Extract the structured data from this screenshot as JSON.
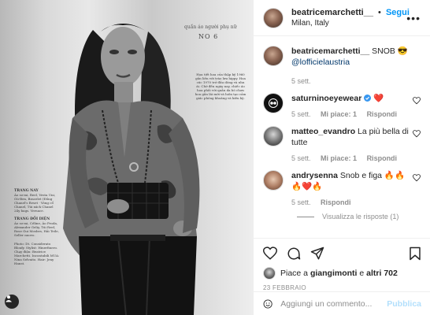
{
  "photo": {
    "issue_label": "NO 6",
    "arc_text": "quần áo người phụ nữ",
    "right_caption": "Họa tiết hoa của thập kỷ 1960 gần liền với trào lưu hippy. Hoa cúc 1970 trở đầu dòng và nhu ái. Chờ đến ngày nay, chiếc áo hoa phối với quần da bó chơn hoa gần lãi mới và luôn tạo cảm giác phóng khoáng và kiêu kỳ.",
    "col_heading_1": "TRANG NAY",
    "col_text_1": "Áo sơ mi, Reel, Vesta Uni, Gü-Ben, Bracelet (Đồng Chanel's Reset · Vòng cổ Chanel, Túi xách Chanel 24y bags. Versace.",
    "col_heading_2": "TRANG ĐỐI DIỆN",
    "col_text_2": "Áo sơ mi, Céline, Áo Proda, Alexander Geliy, Túi Reel, Rose Gui Mosbes, Hải Teile, Seller nuovo.",
    "col_credits": "Photo: Dt. Considerato Bloufy. Stylist: Hinerfinero. Chạy điện: Beatrice Marchetti. Incontabili MUA: Nina Selvaito. Hair: Jeny Hanst."
  },
  "header": {
    "username": "beatricemarchetti__",
    "separator": "•",
    "follow_label": "Segui",
    "location": "Milan, Italy",
    "more_label": "•••"
  },
  "caption": {
    "username": "beatricemarchetti__",
    "text": "SNOB 😎",
    "mention": "@lofficielaustria",
    "time": "5 sett."
  },
  "comments": [
    {
      "username": "saturninoeyewear",
      "text": "❤️",
      "time": "5 sett.",
      "likes": "Mi piace: 1",
      "reply": "Rispondi"
    },
    {
      "username": "matteo_evandro",
      "text": "La più bella di tutte",
      "time": "5 sett.",
      "likes": "Mi piace: 1",
      "reply": "Rispondi"
    },
    {
      "username": "andrysenna",
      "text": "Snob e figa 🔥🔥🔥❤️🔥",
      "time": "5 sett.",
      "reply": "Rispondi"
    }
  ],
  "view_replies": "Visualizza le risposte (1)",
  "likes": {
    "prefix": "Piace a",
    "user": "giangimonti",
    "and": "e",
    "others": "altri 702"
  },
  "date": "23 FEBBRAIO",
  "add_comment": {
    "placeholder": "Aggiungi un commento...",
    "publish_label": "Pubblica"
  },
  "colors": {
    "accent": "#0095f6",
    "publish_disabled": "#b2dffc",
    "heart_red": "#ed4956",
    "verified": "#3897f0"
  },
  "icons": [
    "heart-icon",
    "comment-icon",
    "share-icon",
    "bookmark-icon",
    "emoji-icon",
    "verified-badge-icon",
    "tag-user-icon"
  ]
}
